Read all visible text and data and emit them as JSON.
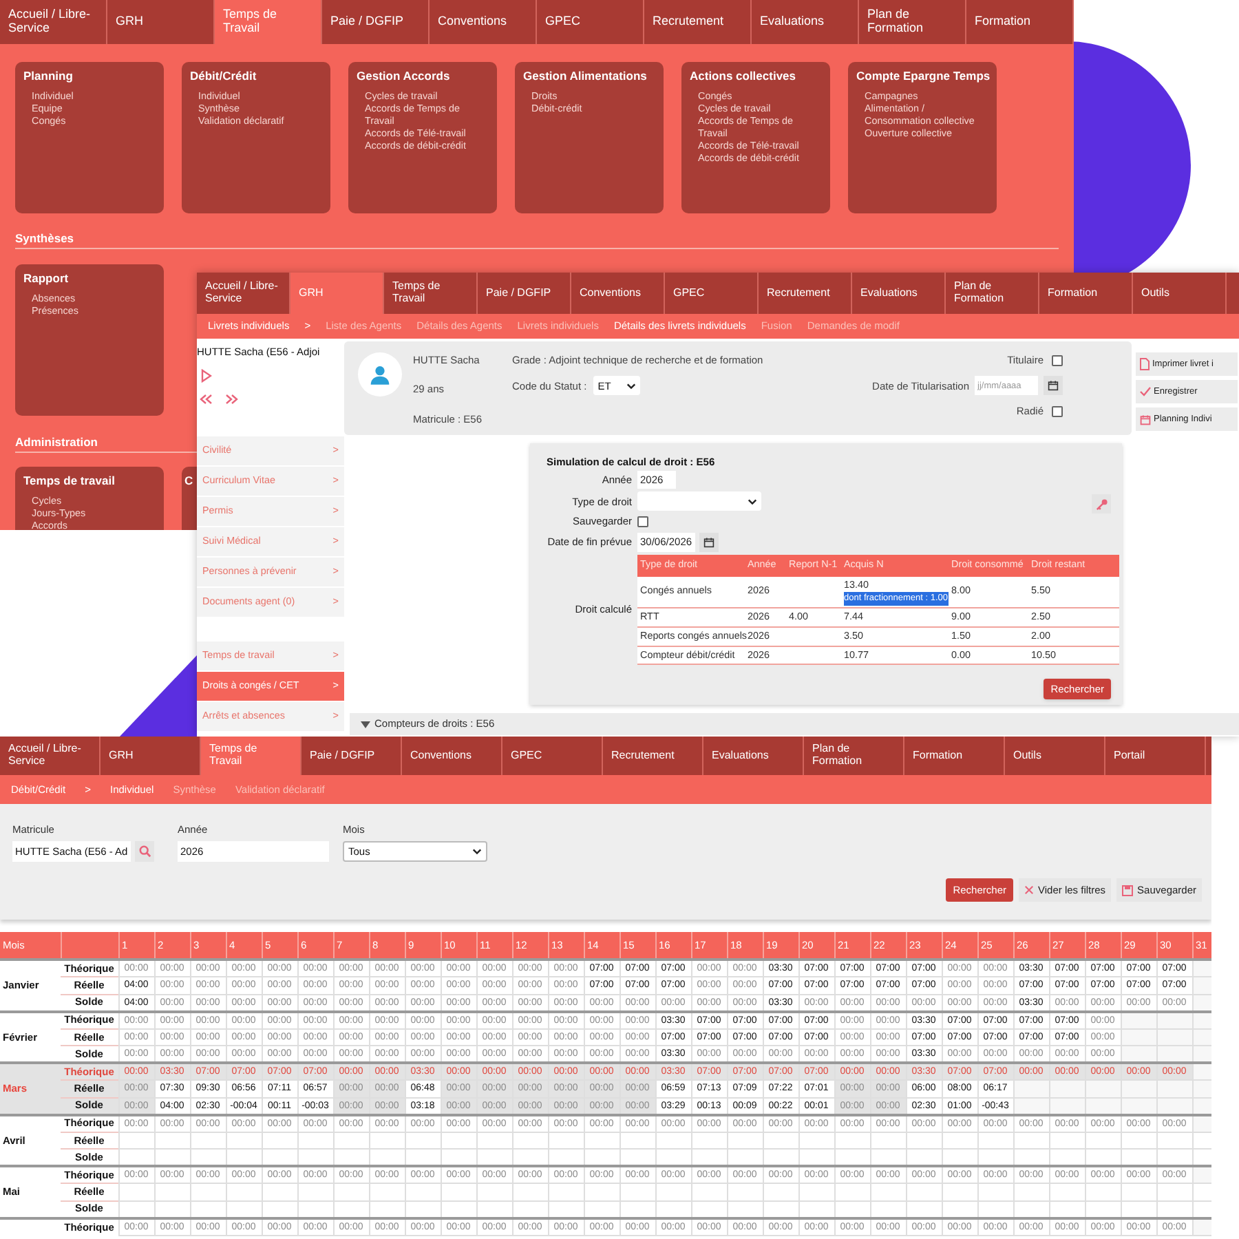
{
  "menu_screen": {
    "tabs": [
      {
        "label": "Accueil / Libre-Service",
        "selected": false
      },
      {
        "label": "GRH",
        "selected": false
      },
      {
        "label": "Temps de Travail",
        "selected": true
      },
      {
        "label": "Paie / DGFIP",
        "selected": false
      },
      {
        "label": "Conventions",
        "selected": false
      },
      {
        "label": "GPEC",
        "selected": false
      },
      {
        "label": "Recrutement",
        "selected": false
      },
      {
        "label": "Evaluations",
        "selected": false
      },
      {
        "label": "Plan de Formation",
        "selected": false
      },
      {
        "label": "Formation",
        "selected": false
      }
    ],
    "cards": [
      {
        "title": "Planning",
        "items": [
          "Individuel",
          "Equipe",
          "Congés"
        ]
      },
      {
        "title": "Débit/Crédit",
        "items": [
          "Individuel",
          "Synthèse",
          "Validation déclaratif"
        ]
      },
      {
        "title": "Gestion Accords",
        "items": [
          "Cycles de travail",
          "Accords de Temps de Travail",
          "Accords de Télé-travail",
          "Accords de débit-crédit"
        ]
      },
      {
        "title": "Gestion Alimentations",
        "items": [
          "Droits",
          "Débit-crédit"
        ]
      },
      {
        "title": "Actions collectives",
        "items": [
          "Congés",
          "Cycles de travail",
          "Accords de Temps de Travail",
          "Accords de Télé-travail",
          "Accords de débit-crédit"
        ]
      },
      {
        "title": "Compte Epargne Temps",
        "items": [
          "Campagnes",
          "Alimentation / Consommation collective",
          "Ouverture collective"
        ]
      }
    ],
    "sections": [
      {
        "title": "Synthèses",
        "cards": [
          {
            "title": "Rapport",
            "items": [
              "Absences",
              "Présences"
            ]
          }
        ]
      },
      {
        "title": "Administration",
        "cards": [
          {
            "title": "Temps de travail",
            "items": [
              "Cycles",
              "Jours-Types",
              "Accords"
            ]
          },
          {
            "title": "C"
          }
        ]
      }
    ]
  },
  "agent_screen": {
    "tabs": [
      {
        "label": "Accueil / Libre-Service",
        "selected": false
      },
      {
        "label": "GRH",
        "selected": true
      },
      {
        "label": "Temps de Travail",
        "selected": false
      },
      {
        "label": "Paie / DGFIP",
        "selected": false
      },
      {
        "label": "Conventions",
        "selected": false
      },
      {
        "label": "GPEC",
        "selected": false
      },
      {
        "label": "Recrutement",
        "selected": false
      },
      {
        "label": "Evaluations",
        "selected": false
      },
      {
        "label": "Plan de Formation",
        "selected": false
      },
      {
        "label": "Formation",
        "selected": false
      },
      {
        "label": "Outils",
        "selected": false
      }
    ],
    "breadcrumb": {
      "section": "Livrets individuels",
      "separator": ">",
      "links": [
        {
          "label": "Liste des Agents",
          "selected": false
        },
        {
          "label": "Détails des Agents",
          "selected": false
        },
        {
          "label": "Livrets individuels",
          "selected": false
        },
        {
          "label": "Détails des livrets individuels",
          "selected": true
        },
        {
          "label": "Fusion",
          "selected": false
        },
        {
          "label": "Demandes de modif",
          "selected": false
        }
      ]
    },
    "sidebar": {
      "agent": "HUTTE Sacha (E56 - Adjoi",
      "groups": [
        [
          {
            "label": "Civilité",
            "arrow": ">",
            "selected": false
          },
          {
            "label": "Curriculum Vitae",
            "arrow": ">",
            "selected": false
          },
          {
            "label": "Permis",
            "arrow": ">",
            "selected": false
          },
          {
            "label": "Suivi Médical",
            "arrow": ">",
            "selected": false
          },
          {
            "label": "Personnes à prévenir",
            "arrow": ">",
            "selected": false
          },
          {
            "label": "Documents agent (0)",
            "arrow": ">",
            "selected": false
          }
        ],
        [
          {
            "label": "Temps de travail",
            "arrow": ">",
            "selected": false
          },
          {
            "label": "Droits à congés / CET",
            "arrow": ">",
            "selected": true
          },
          {
            "label": "Arrêts et absences",
            "arrow": ">",
            "selected": false
          }
        ]
      ]
    },
    "profile": {
      "name": "HUTTE Sacha",
      "age": "29 ans",
      "matricule": "Matricule : E56",
      "grade": "Grade : Adjoint technique de recherche et de formation",
      "statut_label": "Code du Statut :",
      "statut_value": "ET",
      "titulaire": {
        "label": "Titulaire",
        "checked": false
      },
      "titularisation_label": "Date de Titularisation",
      "titularisation_placeholder": "jj/mm/aaaa",
      "radie": {
        "label": "Radié",
        "checked": false
      }
    },
    "actions": [
      {
        "label": "Imprimer livret i",
        "kind": "print"
      },
      {
        "label": "Enregistrer",
        "kind": "save"
      },
      {
        "label": "Planning Indivi",
        "kind": "planning"
      }
    ],
    "simulation": {
      "title": "Simulation de calcul de droit : E56",
      "fields": [
        {
          "label": "Année",
          "kind": "text",
          "value": "2026"
        },
        {
          "label": "Type de droit",
          "kind": "select"
        },
        {
          "label": "Sauvegarder",
          "kind": "checkbox",
          "checked": false
        },
        {
          "label": "Date de fin prévue",
          "kind": "date",
          "value": "30/06/2026"
        }
      ],
      "result_label": "Droit calculé",
      "columns": [
        "Type de droit",
        "Année",
        "Report N-1",
        "Acquis N",
        "Droit consommé",
        "Droit restant"
      ],
      "rows": [
        {
          "cells": [
            "Congés annuels",
            "2026",
            null,
            "13.40",
            "8.00",
            "5.50"
          ],
          "note": {
            "text": "dont fractionnement : 1.00",
            "highlighted": true
          }
        },
        {
          "cells": [
            "RTT",
            "2026",
            "4.00",
            "7.44",
            "9.00",
            "2.50"
          ]
        },
        {
          "cells": [
            "Reports congés annuels",
            "2026",
            null,
            "3.50",
            "1.50",
            "2.00"
          ]
        },
        {
          "cells": [
            "Compteur débit/crédit",
            "2026",
            null,
            "10.77",
            "0.00",
            "10.50"
          ]
        }
      ],
      "button": "Rechercher"
    },
    "counters": "Compteurs de droits : E56"
  },
  "planning_screen": {
    "tabs": [
      {
        "label": "Accueil / Libre-Service",
        "selected": false
      },
      {
        "label": "GRH",
        "selected": false
      },
      {
        "label": "Temps de Travail",
        "selected": true
      },
      {
        "label": "Paie / DGFIP",
        "selected": false
      },
      {
        "label": "Conventions",
        "selected": false
      },
      {
        "label": "GPEC",
        "selected": false
      },
      {
        "label": "Recrutement",
        "selected": false
      },
      {
        "label": "Evaluations",
        "selected": false
      },
      {
        "label": "Plan de Formation",
        "selected": false
      },
      {
        "label": "Formation",
        "selected": false
      },
      {
        "label": "Outils",
        "selected": false
      },
      {
        "label": "Portail",
        "selected": false
      }
    ],
    "breadcrumb": {
      "section": "Débit/Crédit",
      "separator": ">",
      "links": [
        {
          "label": "Individuel",
          "selected": true
        },
        {
          "label": "Synthèse",
          "selected": false
        },
        {
          "label": "Validation déclaratif",
          "selected": false
        }
      ]
    },
    "filters": [
      {
        "label": "Matricule",
        "kind": "search",
        "value": "HUTTE Sacha (E56 - Ad"
      },
      {
        "label": "Année",
        "kind": "text",
        "value": "2026"
      },
      {
        "label": "Mois",
        "kind": "select",
        "value": "Tous"
      }
    ],
    "buttons": [
      {
        "label": "Rechercher",
        "kind": "primary"
      },
      {
        "label": "Vider les filtres",
        "kind": "clear"
      },
      {
        "label": "Sauvegarder",
        "kind": "save"
      }
    ],
    "table": {
      "month_header": "Mois",
      "days": [
        "1",
        "2",
        "3",
        "4",
        "5",
        "6",
        "7",
        "8",
        "9",
        "10",
        "11",
        "12",
        "13",
        "14",
        "15",
        "16",
        "17",
        "18",
        "19",
        "20",
        "21",
        "22",
        "23",
        "24",
        "25",
        "26",
        "27",
        "28",
        "29",
        "30",
        "31"
      ],
      "months": [
        {
          "name": "Janvier",
          "selected": false,
          "rows": [
            {
              "label": "Théorique",
              "values": [
                "00:00",
                "00:00",
                "00:00",
                "00:00",
                "00:00",
                "00:00",
                "00:00",
                "00:00",
                "00:00",
                "00:00",
                "00:00",
                "00:00",
                "00:00",
                "07:00",
                "07:00",
                "07:00",
                "00:00",
                "00:00",
                "03:30",
                "07:00",
                "07:00",
                "07:00",
                "07:00",
                "00:00",
                "00:00",
                "03:30",
                "07:00",
                "07:00",
                "07:00",
                "07:00"
              ]
            },
            {
              "label": "Réelle",
              "values": [
                "04:00",
                "00:00",
                "00:00",
                "00:00",
                "00:00",
                "00:00",
                "00:00",
                "00:00",
                "00:00",
                "00:00",
                "00:00",
                "00:00",
                "00:00",
                "07:00",
                "07:00",
                "07:00",
                "00:00",
                "00:00",
                "07:00",
                "07:00",
                "07:00",
                "07:00",
                "07:00",
                "00:00",
                "00:00",
                "07:00",
                "07:00",
                "07:00",
                "07:00",
                "07:00"
              ]
            },
            {
              "label": "Solde",
              "values": [
                "04:00",
                "00:00",
                "00:00",
                "00:00",
                "00:00",
                "00:00",
                "00:00",
                "00:00",
                "00:00",
                "00:00",
                "00:00",
                "00:00",
                "00:00",
                "00:00",
                "00:00",
                "00:00",
                "00:00",
                "00:00",
                "03:30",
                "00:00",
                "00:00",
                "00:00",
                "00:00",
                "00:00",
                "00:00",
                "03:30",
                "00:00",
                "00:00",
                "00:00",
                "00:00"
              ]
            }
          ]
        },
        {
          "name": "Février",
          "selected": false,
          "rows": [
            {
              "label": "Théorique",
              "values": [
                "00:00",
                "00:00",
                "00:00",
                "00:00",
                "00:00",
                "00:00",
                "00:00",
                "00:00",
                "00:00",
                "00:00",
                "00:00",
                "00:00",
                "00:00",
                "00:00",
                "00:00",
                "03:30",
                "07:00",
                "07:00",
                "07:00",
                "07:00",
                "00:00",
                "00:00",
                "03:30",
                "07:00",
                "07:00",
                "07:00",
                "07:00",
                "00:00"
              ]
            },
            {
              "label": "Réelle",
              "values": [
                "00:00",
                "00:00",
                "00:00",
                "00:00",
                "00:00",
                "00:00",
                "00:00",
                "00:00",
                "00:00",
                "00:00",
                "00:00",
                "00:00",
                "00:00",
                "00:00",
                "00:00",
                "07:00",
                "07:00",
                "07:00",
                "07:00",
                "07:00",
                "00:00",
                "00:00",
                "07:00",
                "07:00",
                "07:00",
                "07:00",
                "07:00",
                "00:00"
              ]
            },
            {
              "label": "Solde",
              "values": [
                "00:00",
                "00:00",
                "00:00",
                "00:00",
                "00:00",
                "00:00",
                "00:00",
                "00:00",
                "00:00",
                "00:00",
                "00:00",
                "00:00",
                "00:00",
                "00:00",
                "00:00",
                "03:30",
                "00:00",
                "00:00",
                "00:00",
                "00:00",
                "00:00",
                "00:00",
                "03:30",
                "00:00",
                "00:00",
                "00:00",
                "00:00",
                "00:00"
              ]
            }
          ]
        },
        {
          "name": "Mars",
          "selected": true,
          "rows": [
            {
              "label": "Théorique",
              "values": [
                "00:00",
                "03:30",
                "07:00",
                "07:00",
                "07:00",
                "07:00",
                "00:00",
                "00:00",
                "03:30",
                "00:00",
                "00:00",
                "00:00",
                "00:00",
                "00:00",
                "00:00",
                "03:30",
                "07:00",
                "07:00",
                "07:00",
                "07:00",
                "00:00",
                "00:00",
                "03:30",
                "07:00",
                "07:00",
                "00:00",
                "00:00",
                "00:00",
                "00:00",
                "00:00"
              ]
            },
            {
              "label": "Réelle",
              "values": [
                "00:00",
                "07:30",
                "09:30",
                "06:56",
                "07:11",
                "06:57",
                "00:00",
                "00:00",
                "06:48",
                "00:00",
                "00:00",
                "00:00",
                "00:00",
                "00:00",
                "00:00",
                "06:59",
                "07:13",
                "07:09",
                "07:22",
                "07:01",
                "00:00",
                "00:00",
                "06:00",
                "08:00",
                "06:17"
              ]
            },
            {
              "label": "Solde",
              "values": [
                "00:00",
                "04:00",
                "02:30",
                "-00:04",
                "00:11",
                "-00:03",
                "00:00",
                "00:00",
                "03:18",
                "00:00",
                "00:00",
                "00:00",
                "00:00",
                "00:00",
                "00:00",
                "03:29",
                "00:13",
                "00:09",
                "00:22",
                "00:01",
                "00:00",
                "00:00",
                "02:30",
                "01:00",
                "-00:43"
              ]
            }
          ]
        },
        {
          "name": "Avril",
          "selected": false,
          "rows": [
            {
              "label": "Théorique",
              "values": [
                "00:00",
                "00:00",
                "00:00",
                "00:00",
                "00:00",
                "00:00",
                "00:00",
                "00:00",
                "00:00",
                "00:00",
                "00:00",
                "00:00",
                "00:00",
                "00:00",
                "00:00",
                "00:00",
                "00:00",
                "00:00",
                "00:00",
                "00:00",
                "00:00",
                "00:00",
                "00:00",
                "00:00",
                "00:00",
                "00:00",
                "00:00",
                "00:00",
                "00:00",
                "00:00"
              ]
            },
            {
              "label": "Réelle"
            },
            {
              "label": "Solde"
            }
          ]
        },
        {
          "name": "Mai",
          "selected": false,
          "rows": [
            {
              "label": "Théorique",
              "values": [
                "00:00",
                "00:00",
                "00:00",
                "00:00",
                "00:00",
                "00:00",
                "00:00",
                "00:00",
                "00:00",
                "00:00",
                "00:00",
                "00:00",
                "00:00",
                "00:00",
                "00:00",
                "00:00",
                "00:00",
                "00:00",
                "00:00",
                "00:00",
                "00:00",
                "00:00",
                "00:00",
                "00:00",
                "00:00",
                "00:00",
                "00:00",
                "00:00",
                "00:00",
                "00:00"
              ]
            },
            {
              "label": "Réelle"
            },
            {
              "label": "Solde"
            }
          ]
        },
        {
          "selected": false,
          "rows": [
            {
              "label": "Théorique",
              "values": [
                "00:00",
                "00:00",
                "00:00",
                "00:00",
                "00:00",
                "00:00",
                "00:00",
                "00:00",
                "00:00",
                "00:00",
                "00:00",
                "00:00",
                "00:00",
                "00:00",
                "00:00",
                "00:00",
                "00:00",
                "00:00",
                "00:00",
                "00:00",
                "00:00",
                "00:00",
                "00:00",
                "00:00",
                "00:00",
                "00:00",
                "00:00",
                "00:00",
                "00:00",
                "00:00"
              ]
            }
          ]
        }
      ]
    }
  }
}
